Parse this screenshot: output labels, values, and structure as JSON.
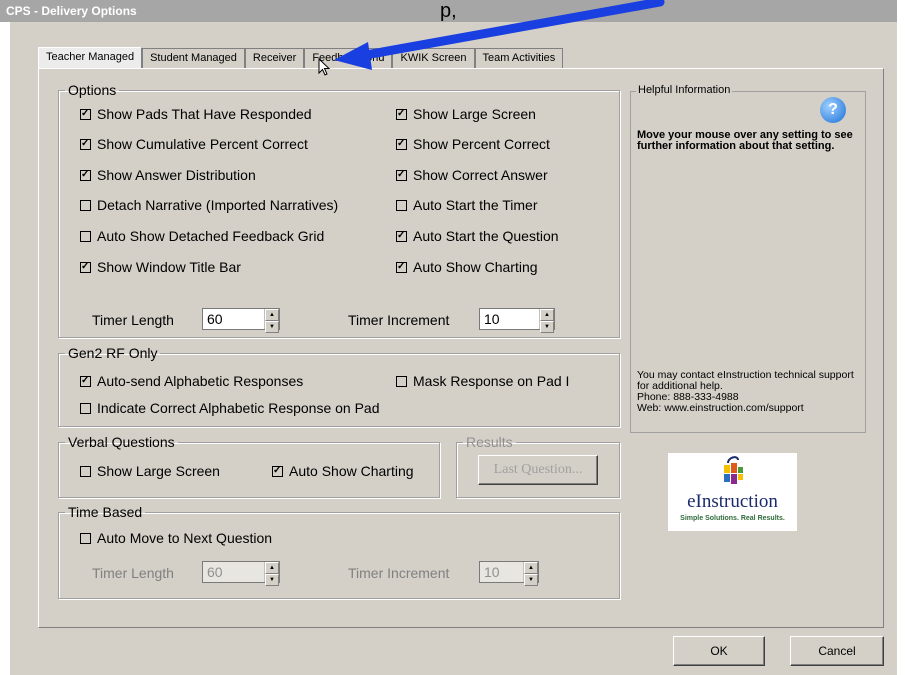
{
  "window": {
    "title": "CPS - Delivery Options"
  },
  "overlay": {
    "top_text": "p,"
  },
  "tabs": [
    {
      "label": "Teacher Managed",
      "active": true
    },
    {
      "label": "Student Managed",
      "active": false
    },
    {
      "label": "Receiver",
      "active": false
    },
    {
      "label": "Feedback Grid",
      "active": false
    },
    {
      "label": "KWIK Screen",
      "active": false
    },
    {
      "label": "Team Activities",
      "active": false
    }
  ],
  "options": {
    "legend": "Options",
    "left": [
      {
        "label": "Show Pads That Have Responded",
        "checked": true
      },
      {
        "label": "Show Cumulative Percent Correct",
        "checked": true
      },
      {
        "label": "Show Answer Distribution",
        "checked": true
      },
      {
        "label": "Detach Narrative (Imported Narratives)",
        "checked": false
      },
      {
        "label": "Auto Show Detached Feedback Grid",
        "checked": false
      },
      {
        "label": "Show Window Title Bar",
        "checked": true
      }
    ],
    "right": [
      {
        "label": "Show Large Screen",
        "checked": true
      },
      {
        "label": "Show Percent Correct",
        "checked": true
      },
      {
        "label": "Show Correct Answer",
        "checked": true
      },
      {
        "label": "Auto Start the Timer",
        "checked": false
      },
      {
        "label": "Auto Start the Question",
        "checked": true
      },
      {
        "label": "Auto Show Charting",
        "checked": true
      }
    ],
    "timer_length_label": "Timer Length",
    "timer_length_value": "60",
    "timer_increment_label": "Timer Increment",
    "timer_increment_value": "10"
  },
  "gen2": {
    "legend": "Gen2 RF Only",
    "auto_send": {
      "label": "Auto-send Alphabetic Responses",
      "checked": true
    },
    "mask": {
      "label": "Mask Response on Pad  I",
      "checked": false
    },
    "indicate": {
      "label": "Indicate Correct Alphabetic Response on Pad",
      "checked": false
    }
  },
  "verbal": {
    "legend": "Verbal Questions",
    "large_screen": {
      "label": "Show Large Screen",
      "checked": false
    },
    "charting": {
      "label": "Auto Show Charting",
      "checked": true
    }
  },
  "results": {
    "legend": "Results",
    "last_question_label": "Last Question..."
  },
  "time_based": {
    "legend": "Time Based",
    "auto_move": {
      "label": "Auto Move to Next Question",
      "checked": false
    },
    "timer_length_label": "Timer Length",
    "timer_length_value": "60",
    "timer_increment_label": "Timer Increment",
    "timer_increment_value": "10"
  },
  "help": {
    "title": "Helpful Information",
    "icon": "help-question-icon",
    "text": "Move your mouse over any setting to see further information about that setting.",
    "contact_1": "You may contact eInstruction technical support for additional help.",
    "contact_2": "Phone: 888-333-4988",
    "contact_3": "Web: www.einstruction.com/support"
  },
  "logo": {
    "word": "eInstruction",
    "tag": "Simple Solutions. Real Results."
  },
  "buttons": {
    "ok": "OK",
    "cancel": "Cancel"
  },
  "colors": {
    "dialog_bg": "#d4d0c8",
    "title_bg": "#a6a6a6",
    "annotation_arrow": "#1a3fe0",
    "help_icon": "#1a6fd6"
  }
}
